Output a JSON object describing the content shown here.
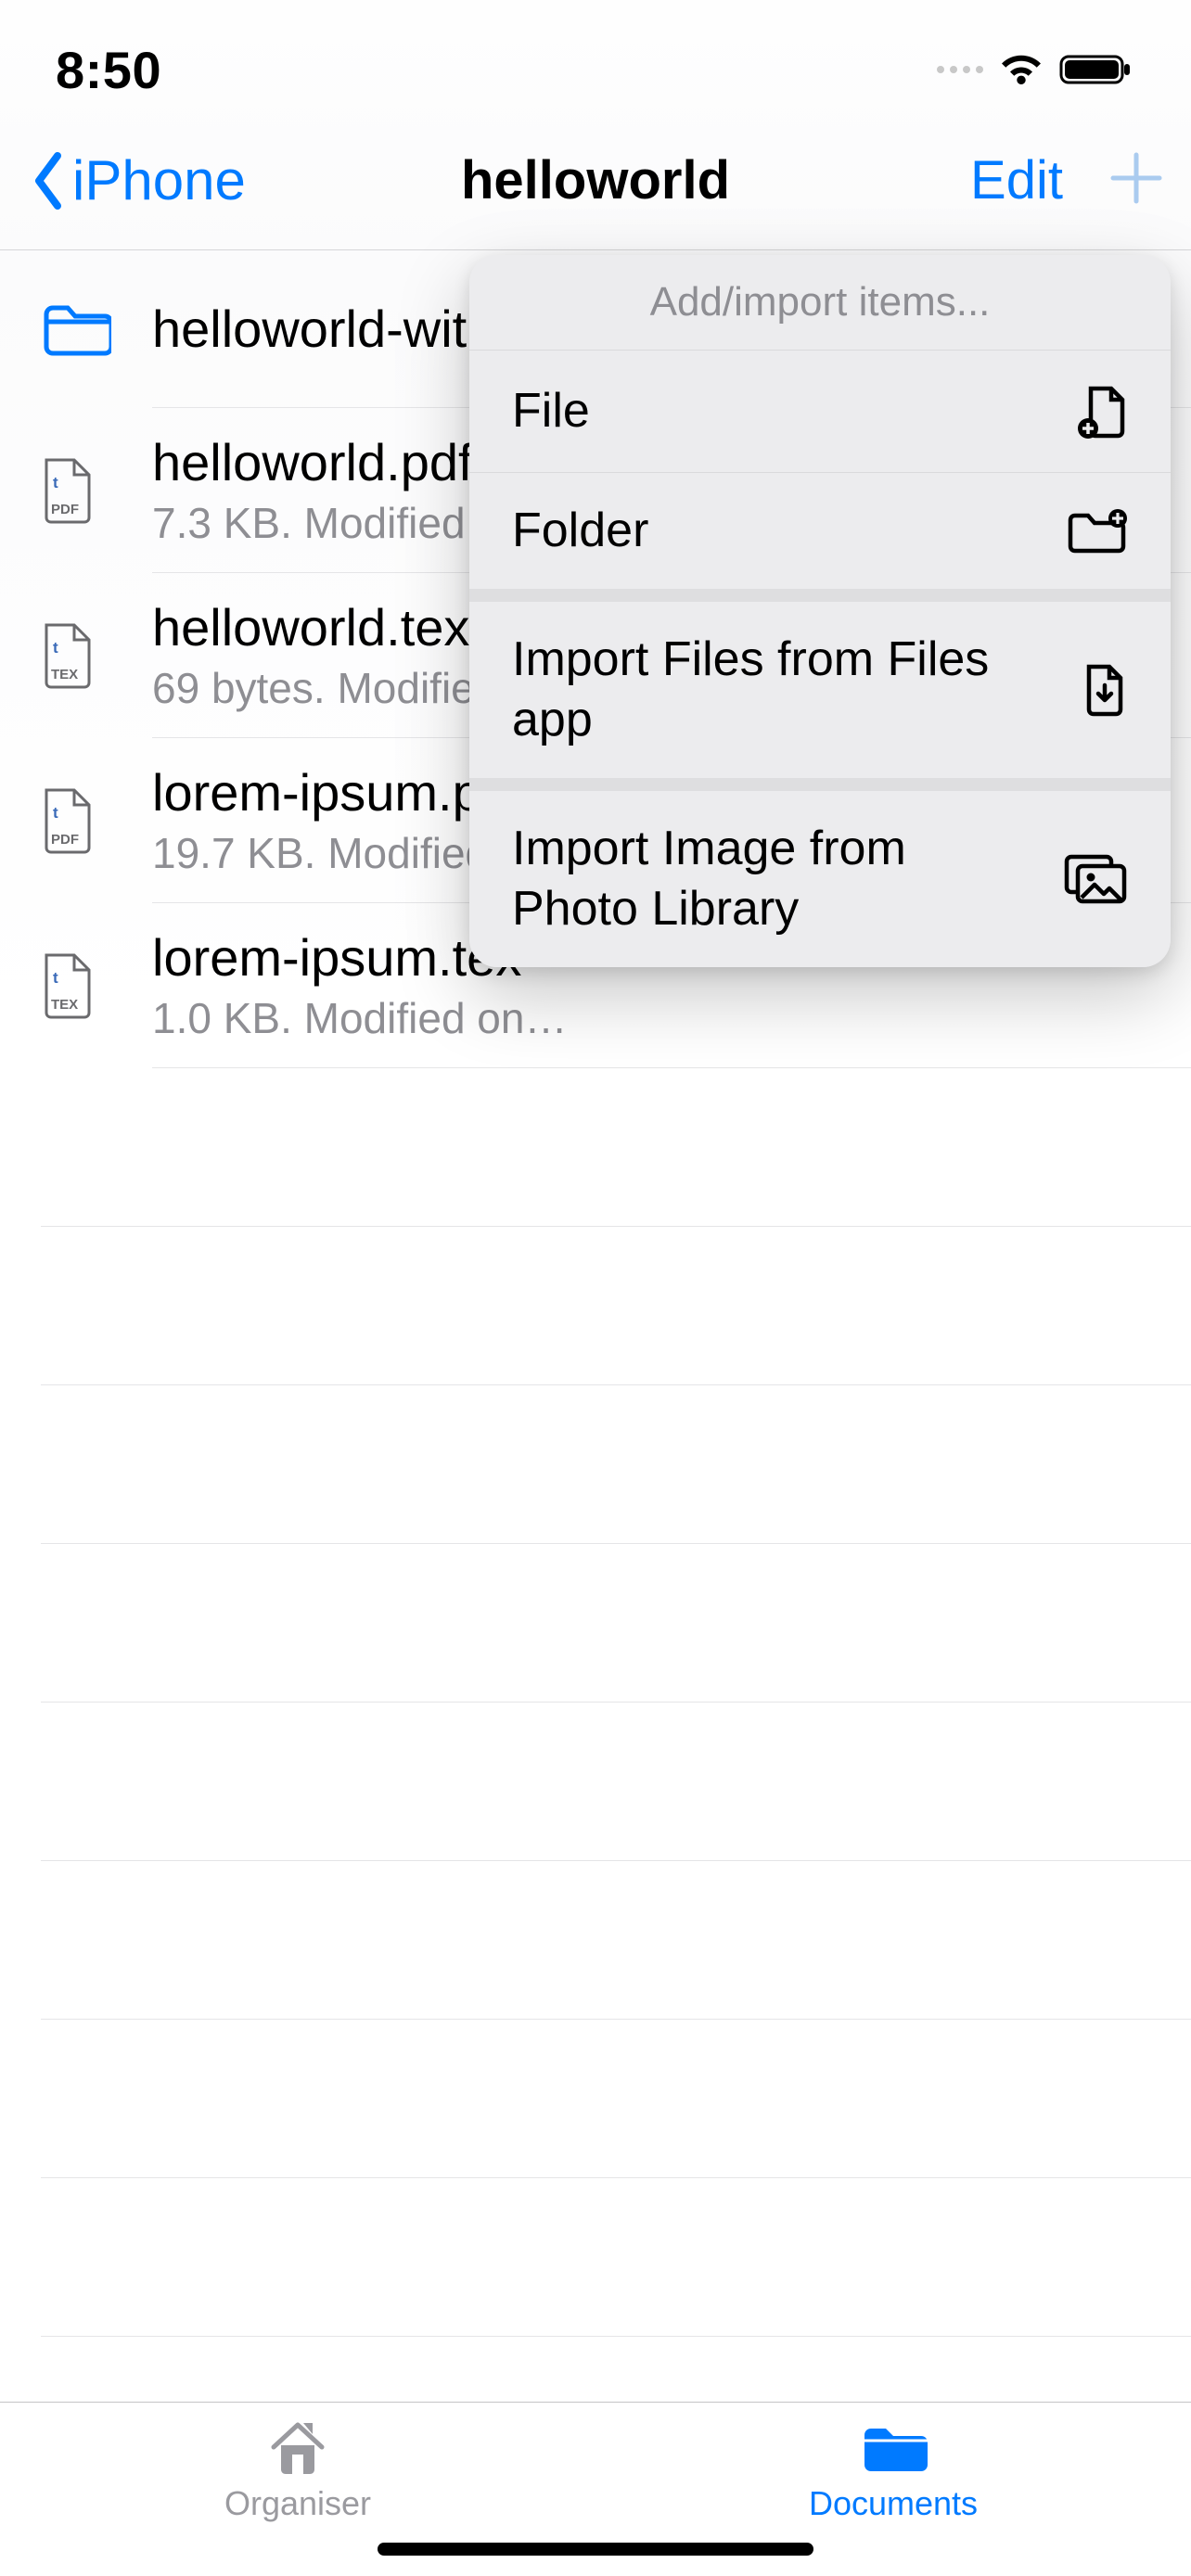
{
  "status": {
    "time": "8:50"
  },
  "nav": {
    "back_label": "iPhone",
    "title": "helloworld",
    "edit_label": "Edit"
  },
  "files": [
    {
      "name": "helloworld-with-…",
      "meta": "",
      "type": "folder"
    },
    {
      "name": "helloworld.pdf",
      "meta": "7.3 KB. Modified on…",
      "type": "pdf"
    },
    {
      "name": "helloworld.tex",
      "meta": "69 bytes. Modified…",
      "type": "tex"
    },
    {
      "name": "lorem-ipsum.pdf",
      "meta": "19.7 KB. Modified o…",
      "type": "pdf"
    },
    {
      "name": "lorem-ipsum.tex",
      "meta": "1.0 KB. Modified on…",
      "type": "tex"
    }
  ],
  "popover": {
    "header": "Add/import items...",
    "items": [
      {
        "label": "File",
        "icon": "file-add"
      },
      {
        "label": "Folder",
        "icon": "folder-add"
      },
      {
        "label": "Import Files from Files app",
        "icon": "file-download"
      },
      {
        "label": "Import Image from Photo Library",
        "icon": "image"
      }
    ]
  },
  "tabs": {
    "organiser": "Organiser",
    "documents": "Documents"
  },
  "colors": {
    "accent": "#007aff",
    "muted": "#8e8e93"
  }
}
